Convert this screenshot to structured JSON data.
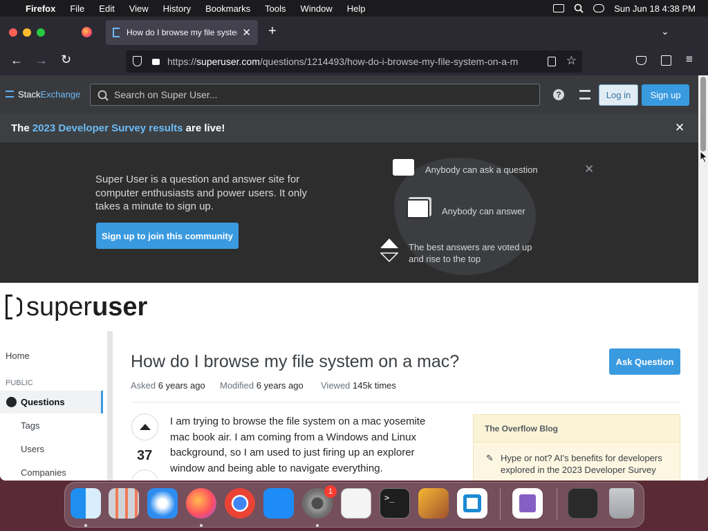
{
  "menubar": {
    "app": "Firefox",
    "items": [
      "File",
      "Edit",
      "View",
      "History",
      "Bookmarks",
      "Tools",
      "Window",
      "Help"
    ],
    "clock": "Sun Jun 18  4:38 PM"
  },
  "browser": {
    "tab_title": "How do I browse my file system",
    "url_prefix": "https://",
    "url_domain": "superuser.com",
    "url_path": "/questions/1214493/how-do-i-browse-my-file-system-on-a-m"
  },
  "header": {
    "brand_stack": "Stack",
    "brand_exchange": "Exchange",
    "search_placeholder": "Search on Super User...",
    "login": "Log in",
    "signup": "Sign up"
  },
  "banner": {
    "pre": "The ",
    "link": "2023 Developer Survey results",
    "post": " are live!"
  },
  "hero": {
    "text": "Super User is a question and answer site for computer enthusiasts and power users. It only takes a minute to sign up.",
    "join_button": "Sign up to join this community",
    "feature1": "Anybody can ask a question",
    "feature2": "Anybody can answer",
    "feature3_line1": "The best answers are voted up",
    "feature3_line2": "and rise to the top"
  },
  "logo": {
    "part1": "super",
    "part2": "user"
  },
  "sidebar": {
    "home": "Home",
    "section": "PUBLIC",
    "questions": "Questions",
    "tags": "Tags",
    "users": "Users",
    "companies": "Companies"
  },
  "question": {
    "title": "How do I browse my file system on a mac?",
    "ask_button": "Ask Question",
    "asked_label": "Asked",
    "asked_value": "6 years ago",
    "modified_label": "Modified",
    "modified_value": "6 years ago",
    "viewed_label": "Viewed",
    "viewed_value": "145k times",
    "votes": "37",
    "body": "I am trying to browse the file system on a mac yosemite mac book air. I am coming from a Windows and Linux background, so I am used to just firing up an explorer window and being able to navigate everything."
  },
  "blog": {
    "title": "The Overflow Blog",
    "item1": "Hype or not? AI's benefits for developers explored in the 2023 Developer Survey"
  },
  "dock": {
    "settings_badge": "1"
  },
  "colors": {
    "accent": "#3a9ae0",
    "survey_link": "#6cbbf7",
    "header_bg": "#383a3e",
    "hero_bg": "#2d2d2d",
    "brand_orange": "#f48225"
  }
}
